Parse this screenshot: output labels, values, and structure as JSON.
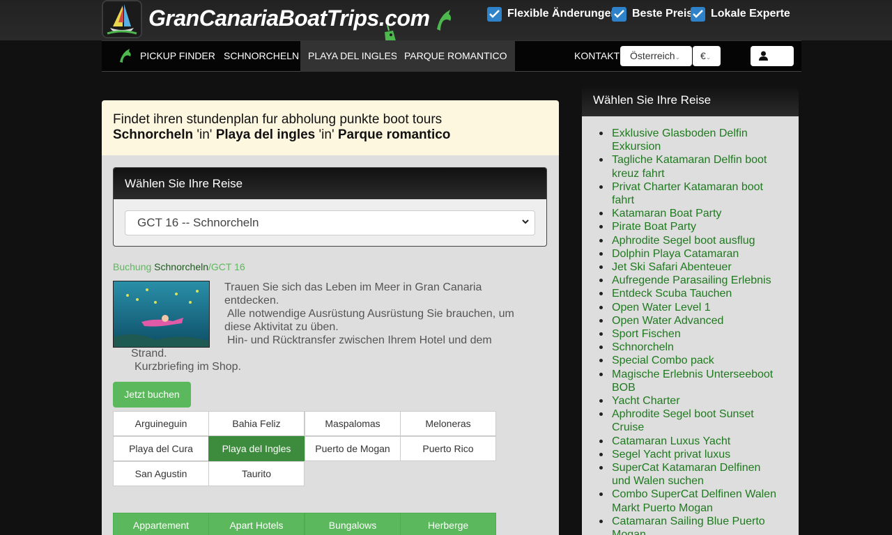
{
  "header": {
    "brand": "GranCanariaBoatTrips.com",
    "features": [
      "Flexible Änderungen",
      "Beste Preis",
      "Lokale Experte"
    ]
  },
  "nav": {
    "items": [
      "PICKUP FINDER",
      "SCHNORCHELN",
      "PLAYA DEL INGLES",
      "PARQUE ROMANTICO"
    ],
    "contact": "KONTAKT",
    "country": "Österreich",
    "currency": "€"
  },
  "notice": {
    "line1": "Findet ihren stundenplan fur abholung punkte boot tours",
    "activity": "Schnorcheln",
    "sep1": " 'in' ",
    "place": "Playa del ingles",
    "sep2": " 'in' ",
    "area": "Parque romantico"
  },
  "trip_select": {
    "heading": "Wählen Sie Ihre Reise",
    "selected": "GCT 16 -- Schnorcheln"
  },
  "breadcrumb": {
    "booking": "Buchung",
    "activity": "Schnorcheln",
    "code": "/GCT 16"
  },
  "description": [
    "Trauen Sie sich das Leben im Meer in Gran Canaria",
    "entdecken.",
    "Alle notwendige Ausrüstung Ausrüstung Sie brauchen, um",
    "diese Aktivitat zu üben.",
    "Hin- und Rücktransfer zwischen Ihrem Hotel und dem",
    "Strand.",
    "Kurzbriefing im Shop."
  ],
  "book_button": "Jetzt buchen",
  "locations": [
    "Arguineguin",
    "Bahia Feliz",
    "Maspalomas",
    "Meloneras",
    "Playa del Cura",
    "Playa del Ingles",
    "Puerto de Mogan",
    "Puerto Rico",
    "San Agustin",
    "Taurito"
  ],
  "active_location": "Playa del Ingles",
  "accommodation_types": [
    "Appartement",
    "Apart Hotels",
    "Bungalows",
    "Herberge"
  ],
  "sidebar": {
    "heading": "Wählen Sie Ihre Reise",
    "trips": [
      [
        "Exklusive Glasboden Delfin",
        "Exkursion"
      ],
      [
        "Tagliche Katamaran Delfin boot",
        "kreuz fahrt"
      ],
      [
        "Privat Charter Katamaran boot",
        "fahrt"
      ],
      [
        "Katamaran Boat Party"
      ],
      [
        "Pirate Boat Party"
      ],
      [
        "Aphrodite Segel boot ausflug"
      ],
      [
        "Dolphin Playa Catamaran"
      ],
      [
        "Jet Ski Safari Abenteuer"
      ],
      [
        "Aufregende Parasailing Erlebnis"
      ],
      [
        "Entdeck Scuba Tauchen"
      ],
      [
        "Open Water Level 1"
      ],
      [
        "Open Water Advanced"
      ],
      [
        "Sport Fischen"
      ],
      [
        "Schnorcheln"
      ],
      [
        "Special Combo pack"
      ],
      [
        "Magische Erlebnis Unterseeboot",
        "BOB"
      ],
      [
        "Yacht Charter"
      ],
      [
        "Aphrodite Segel boot Sunset",
        "Cruise"
      ],
      [
        "Catamaran Luxus Yacht"
      ],
      [
        "Segel Yacht privat luxus"
      ],
      [
        "SuperCat Katamaran Delfinen",
        "und Walen suchen"
      ],
      [
        "Combo SuperCat Delfinen Walen",
        "Markt Puerto Mogan"
      ],
      [
        "Catamaran Sailing Blue Puerto",
        "Mogan"
      ]
    ]
  },
  "colors": {
    "accent_green": "#5cb85c",
    "active_green": "#3d8b3d",
    "link_green": "#1f7a1f",
    "checkbox_blue": "#2d82c9",
    "notice_bg": "#fdf7e0"
  }
}
